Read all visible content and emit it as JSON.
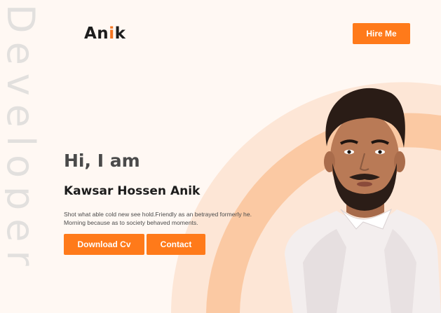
{
  "watermark": {
    "text": "Developer"
  },
  "header": {
    "logo_prefix": "An",
    "logo_accent": "i",
    "logo_suffix": "k",
    "hire_label": "Hire Me"
  },
  "hero": {
    "greeting": "Hi, I am",
    "name": "Kawsar Hossen Anik",
    "description": "Shot what able cold new see hold.Friendly as an betrayed formerly he. Morning because as to society behaved moments.",
    "download_label": "Download Cv",
    "contact_label": "Contact"
  },
  "colors": {
    "accent": "#ff7a1a",
    "background": "#fff8f3",
    "arc_light": "#fde6d6",
    "arc_mid": "#fdd2b3",
    "arc_strong": "#fbb98a"
  }
}
